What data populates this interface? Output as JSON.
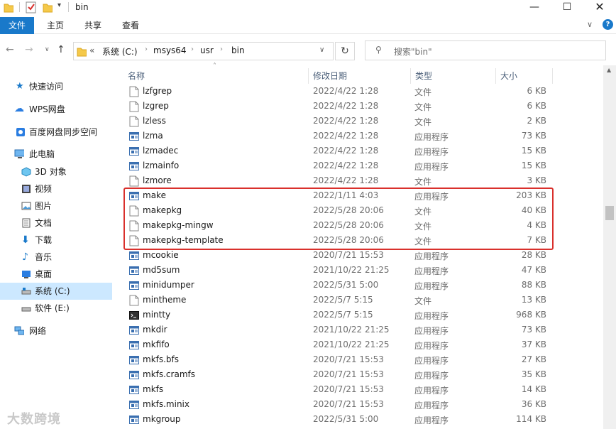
{
  "window": {
    "title": "bin"
  },
  "ribbon": {
    "tabs": [
      "文件",
      "主页",
      "共享",
      "查看"
    ]
  },
  "address": {
    "prefix": "«",
    "parts": [
      "系统 (C:)",
      "msys64",
      "usr",
      "bin"
    ]
  },
  "search": {
    "placeholder": "搜索\"bin\""
  },
  "sidebar": {
    "items": [
      {
        "label": "快速访问",
        "icon": "star-icon"
      },
      {
        "label": "WPS网盘",
        "icon": "cloud-icon"
      },
      {
        "label": "百度网盘同步空间",
        "icon": "baidu-cloud-icon"
      },
      {
        "label": "此电脑",
        "icon": "computer-icon"
      },
      {
        "label": "3D 对象",
        "icon": "3d-objects-icon"
      },
      {
        "label": "视频",
        "icon": "video-icon"
      },
      {
        "label": "图片",
        "icon": "picture-icon"
      },
      {
        "label": "文档",
        "icon": "document-icon"
      },
      {
        "label": "下载",
        "icon": "download-icon"
      },
      {
        "label": "音乐",
        "icon": "music-icon"
      },
      {
        "label": "桌面",
        "icon": "desktop-icon"
      },
      {
        "label": "系统 (C:)",
        "icon": "drive-icon"
      },
      {
        "label": "软件 (E:)",
        "icon": "drive-icon"
      },
      {
        "label": "网络",
        "icon": "network-icon"
      }
    ]
  },
  "columns": {
    "name": "名称",
    "date": "修改日期",
    "type": "类型",
    "size": "大小"
  },
  "files": [
    {
      "name": "lzfgrep",
      "date": "2022/4/22 1:28",
      "type": "文件",
      "size": "6 KB",
      "icon": "file-icon"
    },
    {
      "name": "lzgrep",
      "date": "2022/4/22 1:28",
      "type": "文件",
      "size": "6 KB",
      "icon": "file-icon"
    },
    {
      "name": "lzless",
      "date": "2022/4/22 1:28",
      "type": "文件",
      "size": "2 KB",
      "icon": "file-icon"
    },
    {
      "name": "lzma",
      "date": "2022/4/22 1:28",
      "type": "应用程序",
      "size": "73 KB",
      "icon": "exe-icon"
    },
    {
      "name": "lzmadec",
      "date": "2022/4/22 1:28",
      "type": "应用程序",
      "size": "15 KB",
      "icon": "exe-icon"
    },
    {
      "name": "lzmainfo",
      "date": "2022/4/22 1:28",
      "type": "应用程序",
      "size": "15 KB",
      "icon": "exe-icon"
    },
    {
      "name": "lzmore",
      "date": "2022/4/22 1:28",
      "type": "文件",
      "size": "3 KB",
      "icon": "file-icon"
    },
    {
      "name": "make",
      "date": "2022/1/11 4:03",
      "type": "应用程序",
      "size": "203 KB",
      "icon": "exe-icon"
    },
    {
      "name": "makepkg",
      "date": "2022/5/28 20:06",
      "type": "文件",
      "size": "40 KB",
      "icon": "file-icon"
    },
    {
      "name": "makepkg-mingw",
      "date": "2022/5/28 20:06",
      "type": "文件",
      "size": "4 KB",
      "icon": "file-icon"
    },
    {
      "name": "makepkg-template",
      "date": "2022/5/28 20:06",
      "type": "文件",
      "size": "7 KB",
      "icon": "file-icon"
    },
    {
      "name": "mcookie",
      "date": "2020/7/21 15:53",
      "type": "应用程序",
      "size": "28 KB",
      "icon": "exe-icon"
    },
    {
      "name": "md5sum",
      "date": "2021/10/22 21:25",
      "type": "应用程序",
      "size": "47 KB",
      "icon": "exe-icon"
    },
    {
      "name": "minidumper",
      "date": "2022/5/31 5:00",
      "type": "应用程序",
      "size": "88 KB",
      "icon": "exe-icon"
    },
    {
      "name": "mintheme",
      "date": "2022/5/7 5:15",
      "type": "文件",
      "size": "13 KB",
      "icon": "file-icon"
    },
    {
      "name": "mintty",
      "date": "2022/5/7 5:15",
      "type": "应用程序",
      "size": "968 KB",
      "icon": "terminal-icon"
    },
    {
      "name": "mkdir",
      "date": "2021/10/22 21:25",
      "type": "应用程序",
      "size": "73 KB",
      "icon": "exe-icon"
    },
    {
      "name": "mkfifo",
      "date": "2021/10/22 21:25",
      "type": "应用程序",
      "size": "37 KB",
      "icon": "exe-icon"
    },
    {
      "name": "mkfs.bfs",
      "date": "2020/7/21 15:53",
      "type": "应用程序",
      "size": "27 KB",
      "icon": "exe-icon"
    },
    {
      "name": "mkfs.cramfs",
      "date": "2020/7/21 15:53",
      "type": "应用程序",
      "size": "35 KB",
      "icon": "exe-icon"
    },
    {
      "name": "mkfs",
      "date": "2020/7/21 15:53",
      "type": "应用程序",
      "size": "14 KB",
      "icon": "exe-icon"
    },
    {
      "name": "mkfs.minix",
      "date": "2020/7/21 15:53",
      "type": "应用程序",
      "size": "36 KB",
      "icon": "exe-icon"
    },
    {
      "name": "mkgroup",
      "date": "2022/5/31 5:00",
      "type": "应用程序",
      "size": "114 KB",
      "icon": "exe-icon"
    }
  ],
  "watermark": "大数跨境",
  "colors": {
    "accent": "#1979ca",
    "highlight_border": "#d9302c",
    "selected_nav": "#cce8ff"
  }
}
